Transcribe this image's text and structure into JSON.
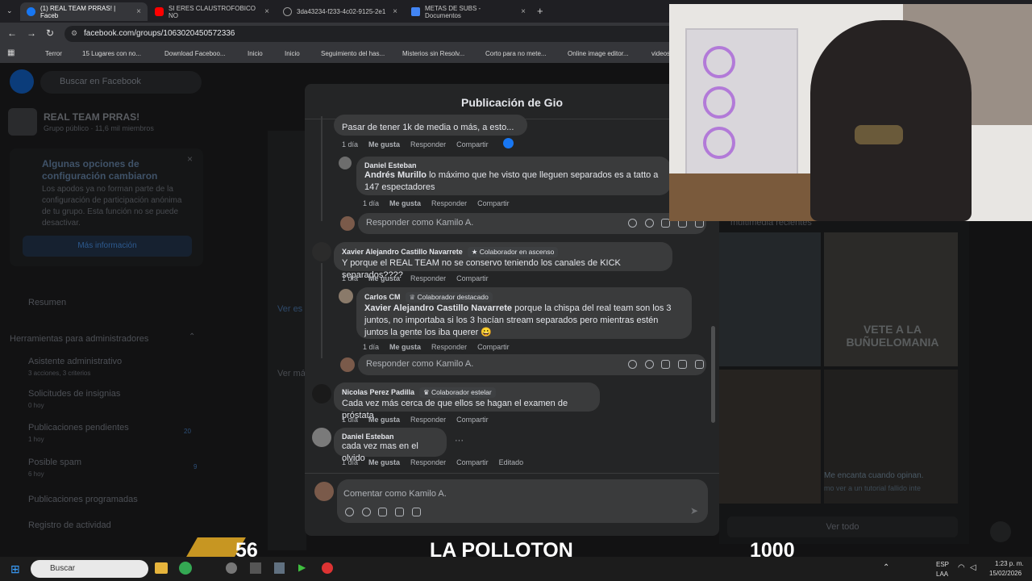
{
  "browser": {
    "tabs": [
      {
        "label": "(1) REAL TEAM PRRAS! | Faceb",
        "active": true,
        "color": "#1877f2"
      },
      {
        "label": "SI ERES CLAUSTROFOBICO NO",
        "active": false,
        "color": "#ff0000"
      },
      {
        "label": "3da43234-f233-4c02-9125-2e1",
        "active": false,
        "color": "#888888"
      },
      {
        "label": "METAS DE SUBS - Documentos",
        "active": false,
        "color": "#4285f4"
      }
    ],
    "url": "facebook.com/groups/1063020450572336",
    "bookmarks": [
      "Terror",
      "15 Lugares con no...",
      "Download Faceboo...",
      "Inicio",
      "Inicio",
      "Seguimiento del has...",
      "Misterios sin Resolv...",
      "Corto para no mete...",
      "Online image editor...",
      "videos"
    ]
  },
  "sidebar": {
    "search_placeholder": "Buscar en Facebook",
    "group_name": "REAL TEAM PRRAS!",
    "group_meta": "Grupo público · 11,6 mil miembros",
    "notice_title": "Algunas opciones de configuración cambiaron",
    "notice_body": "Los apodos ya no forman parte de la configuración de participación anónima de tu grupo. Esta función no se puede desactivar.",
    "more_info": "Más información",
    "summary": "Resumen",
    "admin_tools": "Herramientas para administradores",
    "items": [
      {
        "label": "Asistente administrativo",
        "sub": "3 acciones, 3 criterios"
      },
      {
        "label": "Solicitudes de insignias",
        "sub": "0 hoy"
      },
      {
        "label": "Publicaciones pendientes",
        "sub": "1 hoy",
        "count": "20"
      },
      {
        "label": "Posible spam",
        "sub": "6 hoy",
        "count": "9"
      },
      {
        "label": "Publicaciones programadas",
        "sub": ""
      },
      {
        "label": "Registro de actividad",
        "sub": ""
      }
    ]
  },
  "background": {
    "ver_es": "Ver es",
    "ver_ma": "Ver má",
    "highlights": "multimedia recientes",
    "meme_text": "VETE A LA BUÑUELOMANIA",
    "caption": "Me encanta cuando opinan.",
    "caption2": "mo ver a un tutorial fallido inte",
    "ver_todo": "Ver todo"
  },
  "modal": {
    "title": "Publicación de Gio",
    "c0_text": "Pasar de tener 1k de media o más, a esto...",
    "time": "1 día",
    "like": "Me gusta",
    "respond": "Responder",
    "share": "Compartir",
    "c1_name": "Daniel Esteban",
    "c1_mention": "Andrés Murillo",
    "c1_text": " lo máximo que he visto que lleguen separados es a tatto a 147 espectadores",
    "reply_as": "Responder como Kamilo A.",
    "c2_name": "Xavier Alejandro Castillo Navarrete",
    "c2_badge": "Colaborador en ascenso",
    "c2_text": "Y porque el REAL TEAM no se conservo teniendo los canales de KICK separados????",
    "c3_name": "Carlos CM",
    "c3_badge": "Colaborador destacado",
    "c3_mention": "Xavier Alejandro Castillo Navarrete",
    "c3_text": " porque la chispa del real team son los 3 juntos, no importaba si los 3 hacían stream separados pero mientras estén juntos la gente los iba querer 😀",
    "c4_name": "Nicolas Perez Padilla",
    "c4_badge": "Colaborador estelar",
    "c4_text": "Cada vez más cerca de que ellos se hagan el examen de próstata",
    "c5_name": "Daniel Esteban",
    "c5_text": "cada vez mas en el olvido",
    "edited": "Editado",
    "comment_as": "Comentar como Kamilo A."
  },
  "overlay": {
    "left_number": "56",
    "title": "LA POLLOTON",
    "right_number": "1000"
  },
  "taskbar": {
    "search": "Buscar",
    "lang": "ESP",
    "lang2": "LAA",
    "time": "1:23 p. m.",
    "date": "15/02/2026"
  }
}
